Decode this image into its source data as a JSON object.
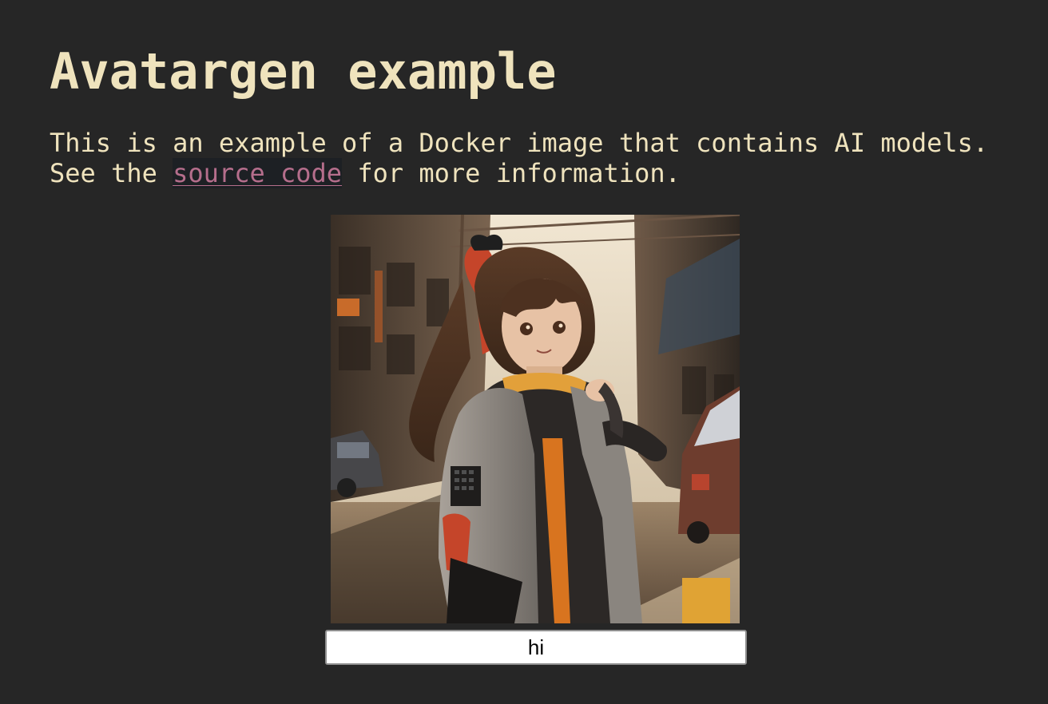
{
  "page": {
    "title": "Avatargen example",
    "intro_line_1": "This is an example of a Docker image that contains AI models.",
    "intro_line_2_before": "See the ",
    "source_link_label": "source code",
    "intro_line_2_after": " for more information."
  },
  "avatar": {
    "alt": "Generated anime avatar: girl with brown ponytail and red ribbon in a jacket on a sunlit city street"
  },
  "prompt": {
    "value": "hi"
  },
  "colors": {
    "background": "#262626",
    "text": "#efe3bd",
    "link": "#b56e8c"
  }
}
